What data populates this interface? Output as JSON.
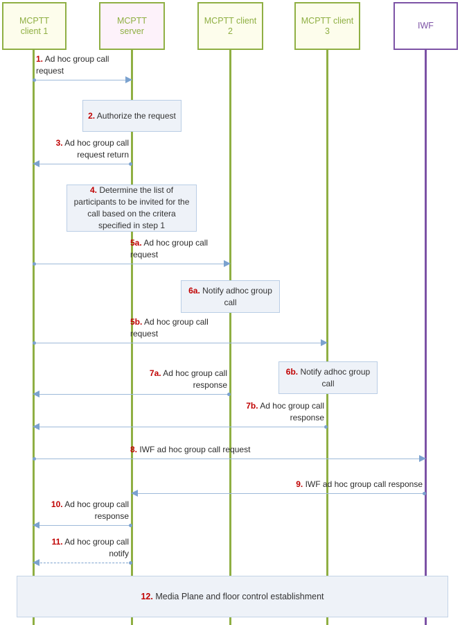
{
  "diagram": {
    "title": "MCPTT ad hoc group call setup sequence",
    "colors": {
      "actor_border": "#8faf43",
      "actor_fill": "#fdfdec",
      "server_fill": "#fdf2fa",
      "iwf_border": "#7c52a5",
      "arrow": "#9db9d9",
      "note_fill": "#eef2f8",
      "note_border": "#b9cde5",
      "step_number": "#c00000"
    }
  },
  "actors": [
    {
      "id": "client1",
      "label": "MCPTT\nclient 1"
    },
    {
      "id": "server",
      "label": "MCPTT\nserver"
    },
    {
      "id": "client2",
      "label": "MCPTT client\n2"
    },
    {
      "id": "client3",
      "label": "MCPTT client\n3"
    },
    {
      "id": "iwf",
      "label": "IWF"
    }
  ],
  "messages": [
    {
      "num": "1.",
      "text": "Ad hoc group call\nrequest",
      "from": "client1",
      "to": "server",
      "dir": "right",
      "style": "solid"
    },
    {
      "num": "3.",
      "text": "Ad hoc group call\nrequest return",
      "from": "server",
      "to": "client1",
      "dir": "left",
      "style": "solid"
    },
    {
      "num": "5a.",
      "text": "Ad hoc group call\nrequest",
      "from": "client1",
      "to": "client2",
      "dir": "right",
      "style": "solid"
    },
    {
      "num": "5b.",
      "text": "Ad hoc group call\nrequest",
      "from": "client1",
      "to": "client3",
      "dir": "right",
      "style": "solid"
    },
    {
      "num": "7a.",
      "text": "Ad hoc group call\nresponse",
      "from": "client2",
      "to": "client1",
      "dir": "left",
      "style": "solid"
    },
    {
      "num": "7b.",
      "text": "Ad hoc group call\nresponse",
      "from": "client3",
      "to": "client1",
      "dir": "left",
      "style": "solid"
    },
    {
      "num": "8.",
      "text": "IWF ad hoc group call request",
      "from": "client1",
      "to": "iwf",
      "dir": "right",
      "style": "solid"
    },
    {
      "num": "9.",
      "text": "IWF ad hoc group call response",
      "from": "iwf",
      "to": "server",
      "dir": "left",
      "style": "solid"
    },
    {
      "num": "10.",
      "text": "Ad hoc group call\nresponse",
      "from": "server",
      "to": "client1",
      "dir": "left",
      "style": "solid"
    },
    {
      "num": "11.",
      "text": "Ad hoc group call\nnotify",
      "from": "server",
      "to": "client1",
      "dir": "left",
      "style": "dashed"
    }
  ],
  "notes": [
    {
      "num": "2.",
      "text": "Authorize the\nrequest"
    },
    {
      "num": "4.",
      "text": "Determine the list of participants\nto be invited for the call based on\nthe critera specified in step 1"
    },
    {
      "num": "6a.",
      "text": "Notify adhoc\ngroup call"
    },
    {
      "num": "6b.",
      "text": "Notify adhoc\ngroup call"
    }
  ],
  "footer_note": {
    "num": "12.",
    "text": "Media Plane and floor control establishment"
  }
}
